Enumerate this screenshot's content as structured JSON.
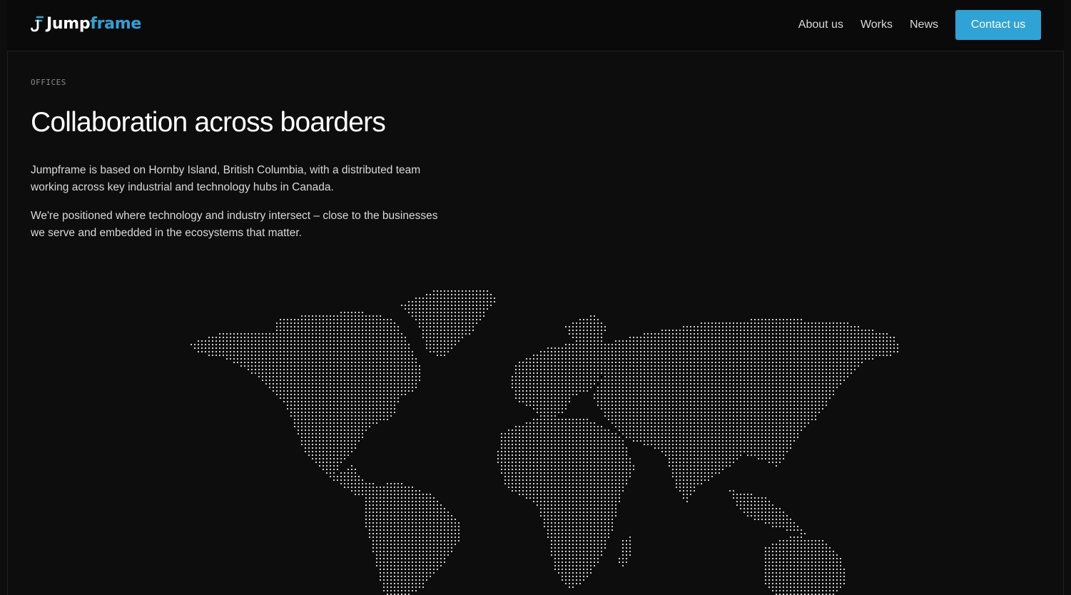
{
  "header": {
    "logo": {
      "icon": "jumpframe-mark-icon",
      "text_primary": "Jump",
      "text_accent": "frame",
      "accent_color": "#2fa3d6"
    },
    "nav": [
      {
        "label": "About us"
      },
      {
        "label": "Works"
      },
      {
        "label": "News"
      }
    ],
    "cta_label": "Contact us"
  },
  "offices": {
    "eyebrow": "OFFICES",
    "title": "Collaboration across boarders",
    "paragraphs": [
      "Jumpframe is based on Hornby Island, British Columbia, with a distributed team working across key industrial and technology hubs in Canada.",
      "We're positioned where technology and industry intersect – close to the businesses we serve and embedded in the ecosystems that matter."
    ]
  },
  "map": {
    "icon": "dotted-world-map",
    "dot_color": "#cfcfcf"
  },
  "colors": {
    "background": "#0d0d0d",
    "accent": "#2fa3d6",
    "text": "#ffffff",
    "muted": "#8a8a8a"
  }
}
